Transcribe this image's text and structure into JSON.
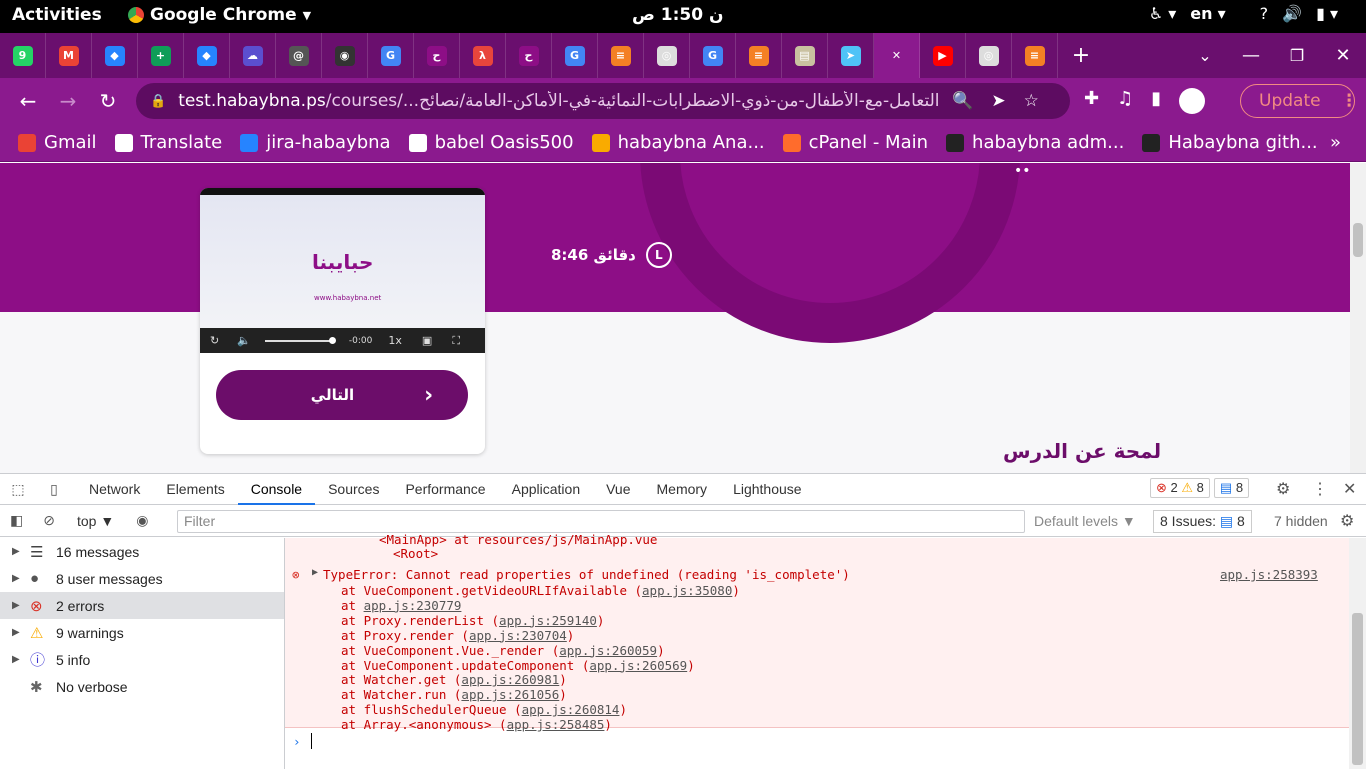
{
  "system_bar": {
    "activities": "Activities",
    "app_name": "Google Chrome",
    "clock": "ن  1:50 ص",
    "language": "en"
  },
  "tabs": [
    {
      "icon": "whatsapp-icon",
      "color": "#25d366",
      "label": "9"
    },
    {
      "icon": "gmail-icon",
      "color": "#ea4335",
      "label": "M"
    },
    {
      "icon": "jira-icon",
      "color": "#2684ff",
      "label": "◆"
    },
    {
      "icon": "sheets-icon",
      "color": "#0f9d58",
      "label": "+"
    },
    {
      "icon": "jira-icon",
      "color": "#2684ff",
      "label": "◆"
    },
    {
      "icon": "cloud-icon",
      "color": "#5b4fcf",
      "label": "☁"
    },
    {
      "icon": "spiral-icon",
      "color": "#555555",
      "label": "@"
    },
    {
      "icon": "github-icon",
      "color": "#333333",
      "label": "◉"
    },
    {
      "icon": "google-icon",
      "color": "#4285f4",
      "label": "G"
    },
    {
      "icon": "habaybna-icon",
      "color": "#8d0e86",
      "label": "ح"
    },
    {
      "icon": "lambda-icon",
      "color": "#e8453c",
      "label": "λ"
    },
    {
      "icon": "habaybna-icon",
      "color": "#8d0e86",
      "label": "ح"
    },
    {
      "icon": "google-icon",
      "color": "#4285f4",
      "label": "G"
    },
    {
      "icon": "stackoverflow-icon",
      "color": "#f48024",
      "label": "≡"
    },
    {
      "icon": "chrome-icon",
      "color": "#dddddd",
      "label": "◎"
    },
    {
      "icon": "google-icon",
      "color": "#4285f4",
      "label": "G"
    },
    {
      "icon": "stackoverflow-icon",
      "color": "#f48024",
      "label": "≡"
    },
    {
      "icon": "appdata-icon",
      "color": "#c9c1a0",
      "label": "▤"
    },
    {
      "icon": "paperplane-icon",
      "color": "#4fc3f7",
      "label": "➤"
    },
    {
      "icon": "close-icon",
      "color": "#8b1a8e",
      "label": "✕",
      "active": true
    },
    {
      "icon": "youtube-icon",
      "color": "#ff0000",
      "label": "▶"
    },
    {
      "icon": "chrome-icon",
      "color": "#dddddd",
      "label": "◎"
    },
    {
      "icon": "stackoverflow-icon",
      "color": "#f48024",
      "label": "≡"
    }
  ],
  "address_bar": {
    "domain": "test.habaybna.ps",
    "path": "/courses/...التعامل-مع-الأطفال-من-ذوي-الاضطرابات-النمائية-في-الأماكن-العامة/نصائح",
    "update_label": "Update"
  },
  "bookmarks": [
    {
      "label": "Gmail",
      "color": "#ea4335"
    },
    {
      "label": "Translate",
      "color": "#ffffff"
    },
    {
      "label": "jira-habaybna",
      "color": "#2684ff"
    },
    {
      "label": "babel Oasis500",
      "color": "#ffffff"
    },
    {
      "label": "habaybna Ana...",
      "color": "#f9ab00"
    },
    {
      "label": "cPanel - Main",
      "color": "#ff6c2c"
    },
    {
      "label": "habaybna adm...",
      "color": "#222222"
    },
    {
      "label": "Habaybna gith...",
      "color": "#222222"
    }
  ],
  "page": {
    "duration": "8:46 دقائق",
    "next_button": "التالي",
    "lesson_heading": "لمحة عن الدرس",
    "video": {
      "logo_text": "حبايبنا",
      "logo_url": "www.habaybna.net",
      "time": "-0:00",
      "speed": "1x"
    }
  },
  "devtools": {
    "tabs": [
      "Network",
      "Elements",
      "Console",
      "Sources",
      "Performance",
      "Application",
      "Vue",
      "Memory",
      "Lighthouse"
    ],
    "active_tab": "Console",
    "error_count": "2",
    "warning_count": "8",
    "message_count": "8",
    "context": "top",
    "filter_placeholder": "Filter",
    "levels": "Default levels",
    "issues": "8 Issues:",
    "issues_count": "8",
    "hidden": "7 hidden",
    "sidebar": [
      {
        "label": "16 messages",
        "icon": "list-icon"
      },
      {
        "label": "8 user messages",
        "icon": "user-icon"
      },
      {
        "label": "2 errors",
        "icon": "error-icon",
        "selected": true
      },
      {
        "label": "9 warnings",
        "icon": "warning-icon"
      },
      {
        "label": "5 info",
        "icon": "info-icon"
      },
      {
        "label": "No verbose",
        "icon": "bug-icon"
      }
    ],
    "console_lines": {
      "pre1": "<MainApp> at resources/js/MainApp.vue",
      "pre2": "<Root>",
      "error_msg": "TypeError: Cannot read properties of undefined (reading 'is_complete')",
      "error_src": "app.js:258393",
      "stack": [
        {
          "fn": "at VueComponent.getVideoURLIfAvailable (",
          "loc": "app.js:35080",
          "end": ")"
        },
        {
          "fn": "at ",
          "loc": "app.js:230779",
          "end": ""
        },
        {
          "fn": "at Proxy.renderList (",
          "loc": "app.js:259140",
          "end": ")"
        },
        {
          "fn": "at Proxy.render (",
          "loc": "app.js:230704",
          "end": ")"
        },
        {
          "fn": "at VueComponent.Vue._render (",
          "loc": "app.js:260059",
          "end": ")"
        },
        {
          "fn": "at VueComponent.updateComponent (",
          "loc": "app.js:260569",
          "end": ")"
        },
        {
          "fn": "at Watcher.get (",
          "loc": "app.js:260981",
          "end": ")"
        },
        {
          "fn": "at Watcher.run (",
          "loc": "app.js:261056",
          "end": ")"
        },
        {
          "fn": "at flushSchedulerQueue (",
          "loc": "app.js:260814",
          "end": ")"
        },
        {
          "fn": "at Array.<anonymous> (",
          "loc": "app.js:258485",
          "end": ")"
        }
      ]
    }
  }
}
